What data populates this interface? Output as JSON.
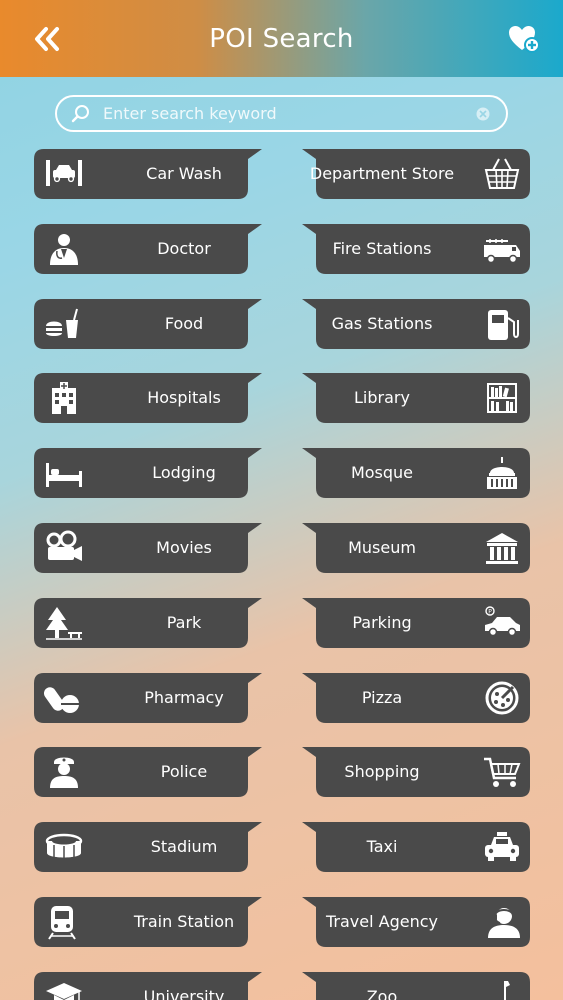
{
  "header": {
    "title": "POI Search",
    "back_icon": "double-chevron-left-icon",
    "favorites_icon": "heart-plus-icon"
  },
  "search": {
    "placeholder": "Enter search keyword",
    "value": ""
  },
  "colors": {
    "button_fill": "#4a4a4a",
    "header_left": "#e98a2c",
    "header_right": "#1ba9cc"
  },
  "categories": [
    {
      "label": "Car Wash",
      "icon": "car-wash-icon"
    },
    {
      "label": "Department Store",
      "icon": "basket-icon"
    },
    {
      "label": "Doctor",
      "icon": "doctor-icon"
    },
    {
      "label": "Fire Stations",
      "icon": "fire-truck-icon"
    },
    {
      "label": "Food",
      "icon": "fast-food-icon"
    },
    {
      "label": "Gas Stations",
      "icon": "gas-pump-icon"
    },
    {
      "label": "Hospitals",
      "icon": "hospital-building-icon"
    },
    {
      "label": "Library",
      "icon": "bookshelf-icon"
    },
    {
      "label": "Lodging",
      "icon": "bed-icon"
    },
    {
      "label": "Mosque",
      "icon": "dome-icon"
    },
    {
      "label": "Movies",
      "icon": "film-camera-icon"
    },
    {
      "label": "Museum",
      "icon": "museum-icon"
    },
    {
      "label": "Park",
      "icon": "tree-icon"
    },
    {
      "label": "Parking",
      "icon": "parked-car-icon"
    },
    {
      "label": "Pharmacy",
      "icon": "pills-icon"
    },
    {
      "label": "Pizza",
      "icon": "pizza-icon"
    },
    {
      "label": "Police",
      "icon": "police-officer-icon"
    },
    {
      "label": "Shopping",
      "icon": "shopping-cart-icon"
    },
    {
      "label": "Stadium",
      "icon": "stadium-icon"
    },
    {
      "label": "Taxi",
      "icon": "taxi-icon"
    },
    {
      "label": "Train Station",
      "icon": "train-icon"
    },
    {
      "label": "Travel Agency",
      "icon": "agent-headset-icon"
    },
    {
      "label": "University",
      "icon": "graduation-cap-icon"
    },
    {
      "label": "Zoo",
      "icon": "giraffe-icon"
    }
  ]
}
